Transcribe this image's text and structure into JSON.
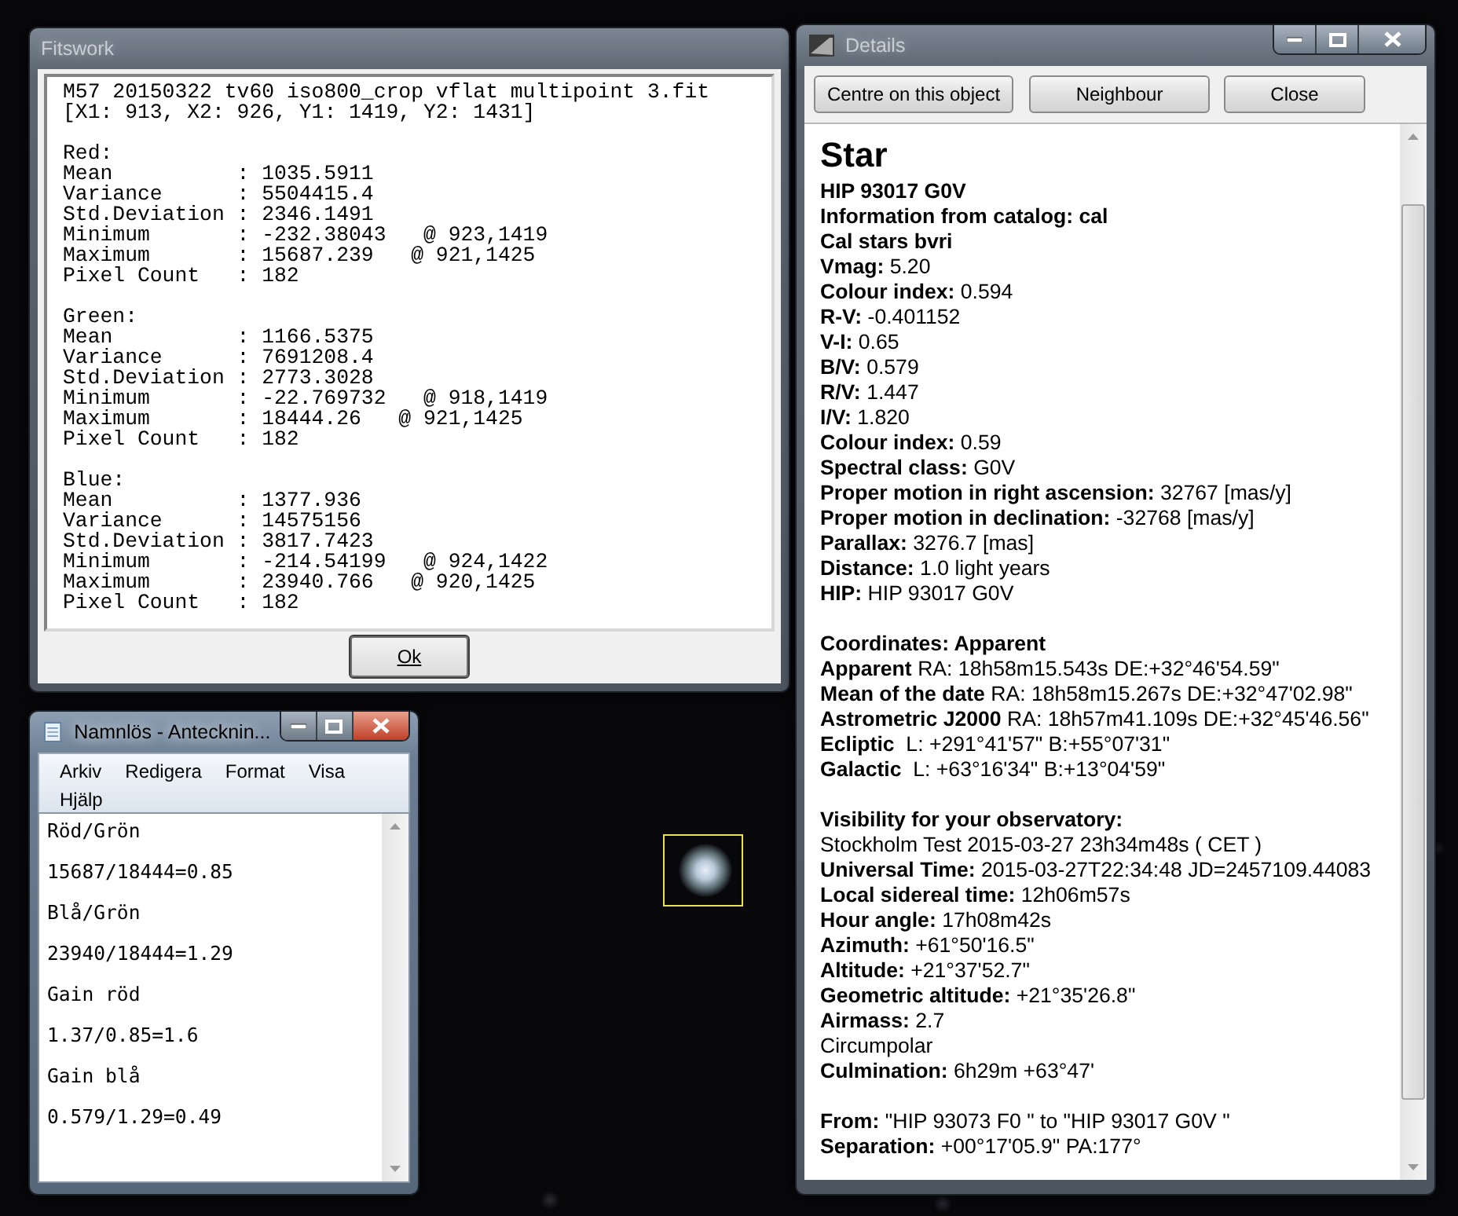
{
  "fitswork": {
    "title": "Fitswork",
    "active": false,
    "header": [
      "M57 20150322 tv60 iso800_crop vflat multipoint 3.fit",
      "[X1: 913, X2: 926, Y1: 1419, Y2: 1431]"
    ],
    "channels": [
      {
        "name": "Red:",
        "rows": [
          {
            "label": "Mean",
            "value": ": 1035.5911"
          },
          {
            "label": "Variance",
            "value": ": 5504415.4"
          },
          {
            "label": "Std.Deviation",
            "value": ": 2346.1491"
          },
          {
            "label": "Minimum",
            "value": ": -232.38043   @ 923,1419"
          },
          {
            "label": "Maximum",
            "value": ": 15687.239   @ 921,1425"
          },
          {
            "label": "Pixel Count",
            "value": ": 182"
          }
        ]
      },
      {
        "name": "Green:",
        "rows": [
          {
            "label": "Mean",
            "value": ": 1166.5375"
          },
          {
            "label": "Variance",
            "value": ": 7691208.4"
          },
          {
            "label": "Std.Deviation",
            "value": ": 2773.3028"
          },
          {
            "label": "Minimum",
            "value": ": -22.769732   @ 918,1419"
          },
          {
            "label": "Maximum",
            "value": ": 18444.26   @ 921,1425"
          },
          {
            "label": "Pixel Count",
            "value": ": 182"
          }
        ]
      },
      {
        "name": "Blue:",
        "rows": [
          {
            "label": "Mean",
            "value": ": 1377.936"
          },
          {
            "label": "Variance",
            "value": ": 14575156"
          },
          {
            "label": "Std.Deviation",
            "value": ": 3817.7423"
          },
          {
            "label": "Minimum",
            "value": ": -214.54199   @ 924,1422"
          },
          {
            "label": "Maximum",
            "value": ": 23940.766   @ 920,1425"
          },
          {
            "label": "Pixel Count",
            "value": ": 182"
          }
        ]
      }
    ],
    "button": "Ok"
  },
  "notepad": {
    "title": "Namnlös - Antecknin...",
    "active": true,
    "menu": [
      "Arkiv",
      "Redigera",
      "Format",
      "Visa",
      "Hjälp"
    ],
    "lines": [
      "Röd/Grön",
      "15687/18444=0.85",
      "Blå/Grön",
      "23940/18444=1.29",
      "Gain röd",
      "1.37/0.85=1.6",
      "Gain blå",
      "0.579/1.29=0.49"
    ]
  },
  "details": {
    "title": "Details",
    "active": false,
    "buttons": [
      "Centre on this object",
      "Neighbour",
      "Close"
    ],
    "heading": "Star",
    "sections": [
      [
        "**HIP 93017 G0V**",
        "**Information from catalog: cal**",
        "**Cal stars bvri**",
        "**Vmag:** 5.20",
        "**Colour index:** 0.594",
        "**R-V:** -0.401152",
        "**V-I:** 0.65",
        "**B/V:** 0.579",
        "**R/V:** 1.447",
        "**I/V:** 1.820",
        "**Colour index:** 0.59",
        "**Spectral class:** G0V",
        "**Proper motion in right ascension:** 32767 [mas/y]",
        "**Proper motion in declination:** -32768 [mas/y]",
        "**Parallax:** 3276.7 [mas]",
        "**Distance:** 1.0 light years",
        "**HIP:** HIP 93017 G0V"
      ],
      [
        "**Coordinates: Apparent**",
        "**Apparent** RA: 18h58m15.543s DE:+32°46'54.59\"",
        "**Mean of the date** RA: 18h58m15.267s DE:+32°47'02.98\"",
        "**Astrometric J2000** RA: 18h57m41.109s DE:+32°45'46.56\"",
        "**Ecliptic**  L: +291°41'57\" B:+55°07'31\"",
        "**Galactic**  L: +63°16'34\" B:+13°04'59\""
      ],
      [
        "**Visibility for your observatory:**",
        "Stockholm Test 2015-03-27 23h34m48s ( CET )",
        "**Universal Time:** 2015-03-27T22:34:48 JD=2457109.44083",
        "**Local sidereal time:** 12h06m57s",
        "**Hour angle:** 17h08m42s",
        "**Azimuth:** +61°50'16.5\"",
        "**Altitude:** +21°37'52.7\"",
        "**Geometric altitude:** +21°35'26.8\"",
        "**Airmass:** 2.7",
        "Circumpolar",
        "**Culmination:** 6h29m +63°47'"
      ],
      [
        "**From:** \"HIP 93073 F0 \" to \"HIP 93017 G0V \"",
        "**Separation:** +00°17'05.9\" PA:177°"
      ]
    ]
  }
}
